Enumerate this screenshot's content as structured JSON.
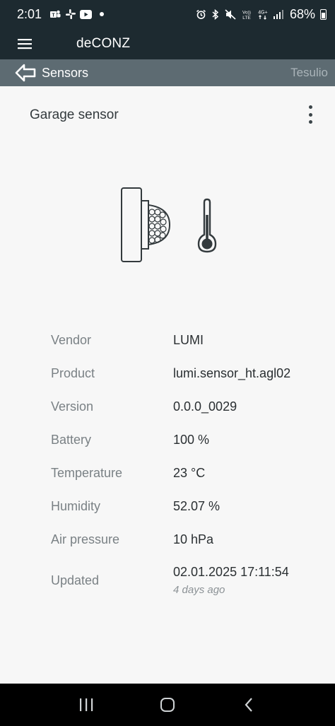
{
  "status_bar": {
    "time": "2:01",
    "battery": "68%",
    "notification_icons": [
      "teams-icon",
      "slack-icon",
      "youtube-icon"
    ],
    "system_icons": [
      "alarm-icon",
      "bluetooth-icon",
      "mute-icon",
      "volte-icon",
      "4g-icon",
      "signal-icon"
    ]
  },
  "app_bar": {
    "title": "deCONZ"
  },
  "breadcrumb": {
    "back_label": "Sensors",
    "gateway": "Tesulio"
  },
  "sensor": {
    "name": "Garage sensor",
    "icons": [
      "motion-sensor-icon",
      "thermometer-icon"
    ]
  },
  "details": [
    {
      "label": "Vendor",
      "value": "LUMI"
    },
    {
      "label": "Product",
      "value": "lumi.sensor_ht.agl02"
    },
    {
      "label": "Version",
      "value": "0.0.0_0029"
    },
    {
      "label": "Battery",
      "value": "100 %"
    },
    {
      "label": "Temperature",
      "value": "23 °C"
    },
    {
      "label": "Humidity",
      "value": "52.07 %"
    },
    {
      "label": "Air pressure",
      "value": "10 hPa"
    }
  ],
  "updated": {
    "label": "Updated",
    "value": "02.01.2025 17:11:54",
    "relative": "4 days ago"
  },
  "colors": {
    "app_bar": "#1d2a30",
    "crumb_bar": "#5d6b72",
    "background": "#f7f7f7"
  }
}
